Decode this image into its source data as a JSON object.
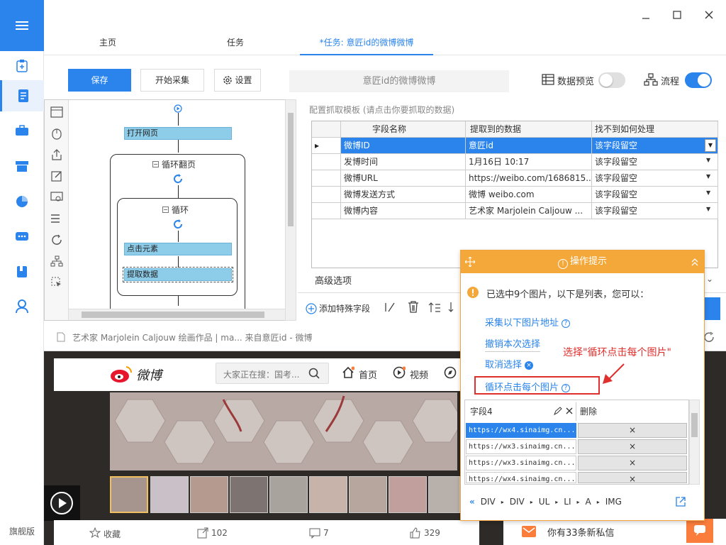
{
  "nav": {
    "edition": "旗舰版"
  },
  "tabs": [
    "主页",
    "任务",
    "*任务: 意匠id的微博微博"
  ],
  "toolbar": {
    "save": "保存",
    "start": "开始采集",
    "settings": "设置",
    "task_name": "意匠id的微博微博",
    "data_preview": "数据预览",
    "flow": "流程"
  },
  "flow": {
    "nodes": {
      "open_page": "打开网页",
      "loop_paging": "循环翻页",
      "loop": "循环",
      "click_element": "点击元素",
      "extract": "提取数据"
    }
  },
  "template": {
    "title": "配置抓取模板 (请点击你要抓取的数据)",
    "headers": [
      "字段名称",
      "提取到的数据",
      "找不到如何处理"
    ],
    "rows": [
      {
        "name": "微博ID",
        "value": "意匠id",
        "handle": "该字段留空"
      },
      {
        "name": "发博时间",
        "value": "1月16日 10:17",
        "handle": "该字段留空"
      },
      {
        "name": "微博URL",
        "value": "https://weibo.com/1686815...",
        "handle": "该字段留空"
      },
      {
        "name": "微博发送方式",
        "value": "微博 weibo.com",
        "handle": "该字段留空"
      },
      {
        "name": "微博内容",
        "value": "艺术家 Marjolein Caljouw ...",
        "handle": "该字段留空"
      }
    ],
    "advanced": "高级选项",
    "add_field": "添加特殊字段"
  },
  "hint": {
    "title": "操作提示",
    "message": "已选中9个图片，以下是列表，您可以：",
    "actions": [
      "采集以下图片地址",
      "撤销本次选择",
      "取消选择",
      "循环点击每个图片"
    ],
    "table_headers": [
      "字段4",
      "删除"
    ],
    "urls": [
      "https://wx4.sinaimg.cn...",
      "https://wx3.sinaimg.cn...",
      "https://wx3.sinaimg.cn...",
      "https://wx4.sinaimg.cn..."
    ],
    "delete_mark": "×",
    "path": [
      "DIV",
      "DIV",
      "UL",
      "LI",
      "A",
      "IMG"
    ],
    "annotation": "选择\"循环点击每个图片\""
  },
  "browser": {
    "address": "艺术家 Marjolein Caljouw 绘画作品 | ma... 来自意匠id - 微博",
    "logo": "微博",
    "search_placeholder": "大家正在搜：国考...",
    "home": "首页",
    "video": "视频",
    "favorite": "收藏",
    "repost_count": "102",
    "comment_count": "7",
    "like_count": "329",
    "message": "你有33条新私信"
  },
  "colors": {
    "accent": "#2a84ec",
    "hint_orange": "#f5a83a",
    "node_blue": "#8ecdea",
    "annotation_red": "#e0302e"
  }
}
